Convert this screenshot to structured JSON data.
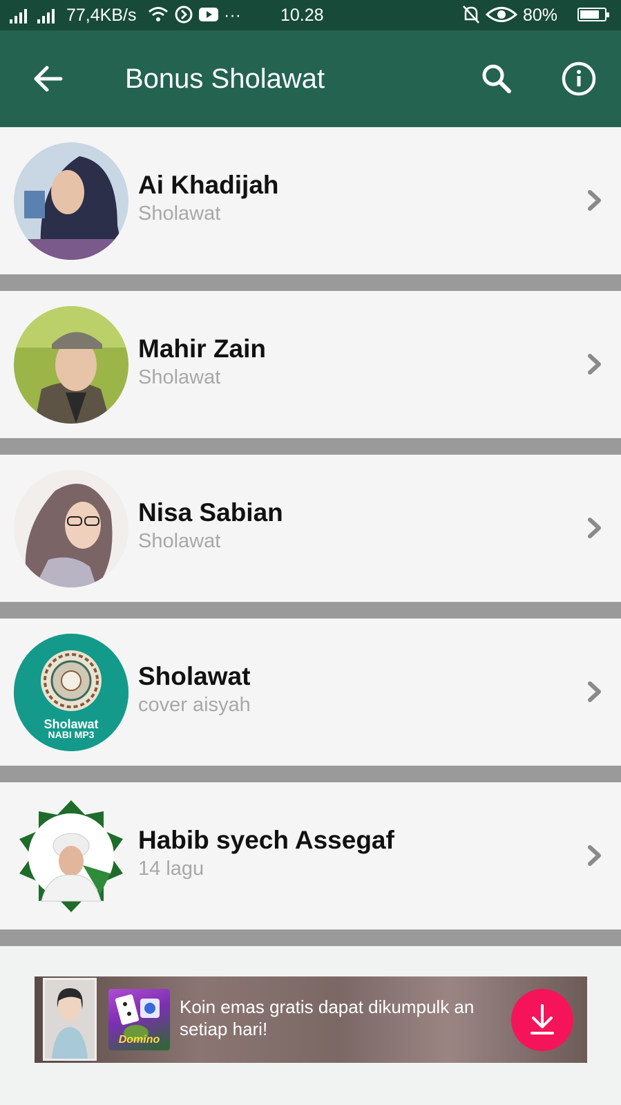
{
  "status_bar": {
    "network_speed": "77,4KB/s",
    "more": "···",
    "time": "10.28",
    "battery": "80%",
    "battery_level": 0.8
  },
  "app_bar": {
    "title": "Bonus Sholawat",
    "icons": [
      "back-arrow-icon",
      "search-icon",
      "info-icon"
    ]
  },
  "list": [
    {
      "name": "Ai Khadijah",
      "subtitle": "Sholawat"
    },
    {
      "name": "Mahir Zain",
      "subtitle": "Sholawat"
    },
    {
      "name": "Nisa Sabian",
      "subtitle": "Sholawat"
    },
    {
      "name": "Sholawat",
      "subtitle": "cover aisyah",
      "logo_text_1": "Sholawat",
      "logo_text_2": "NABI MP3"
    },
    {
      "name": "Habib syech Assegaf",
      "subtitle": "14 lagu"
    }
  ],
  "ad": {
    "game_label": "Domino",
    "text": "Koin emas gratis dapat dikumpulk an setiap hari!",
    "button_icon": "download-icon"
  },
  "colors": {
    "status_bar": "#174a39",
    "app_bar": "#24634f",
    "separator": "#9a9a9a",
    "row_bg": "#f5f5f5",
    "download_button": "#f5145a"
  }
}
